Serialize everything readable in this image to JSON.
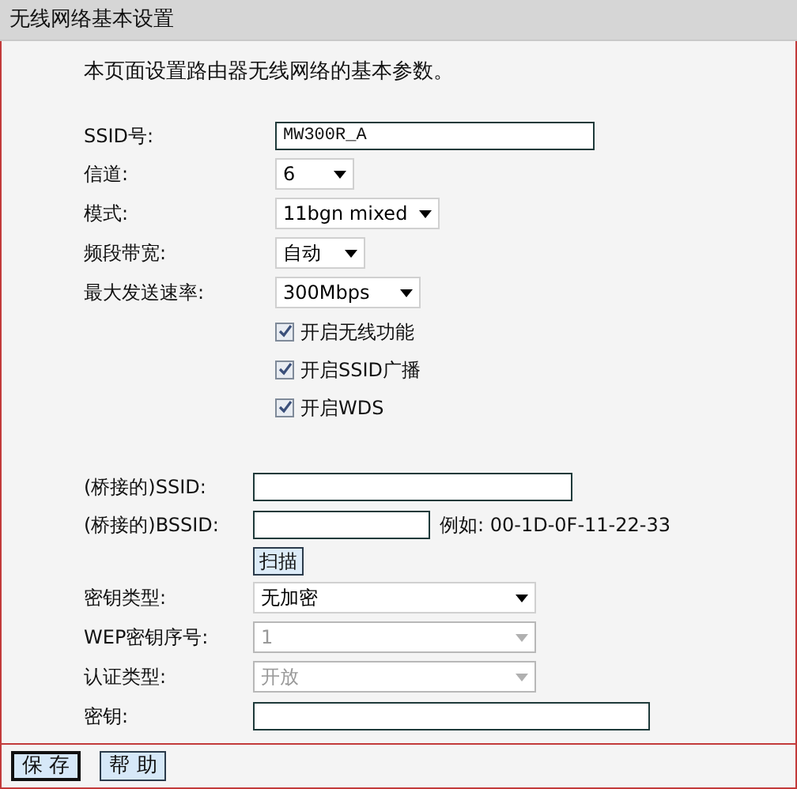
{
  "header": {
    "title": "无线网络基本设置"
  },
  "intro": "本页面设置路由器无线网络的基本参数。",
  "basic": [
    {
      "kind": "text",
      "label": "SSID号:",
      "value": "MW300R_A"
    },
    {
      "kind": "select",
      "label": "信道:",
      "value": "6",
      "disabled": false
    },
    {
      "kind": "select",
      "label": "模式:",
      "value": "11bgn mixed",
      "disabled": false
    },
    {
      "kind": "select",
      "label": "频段带宽:",
      "value": "自动",
      "disabled": false
    },
    {
      "kind": "select",
      "label": "最大发送速率:",
      "value": "300Mbps",
      "disabled": false
    },
    {
      "kind": "checkbox",
      "label": "开启无线功能",
      "checked": true
    },
    {
      "kind": "checkbox",
      "label": "开启SSID广播",
      "checked": true
    },
    {
      "kind": "checkbox",
      "label": "开启WDS",
      "checked": true
    }
  ],
  "wds": [
    {
      "kind": "text",
      "label": "(桥接的)SSID:"
    },
    {
      "kind": "text",
      "label": "(桥接的)BSSID:",
      "hint": "例如: 00-1D-0F-11-22-33"
    },
    {
      "kind": "button",
      "label": "扫描"
    },
    {
      "kind": "select",
      "label": "密钥类型:",
      "value": "无加密",
      "disabled": false
    },
    {
      "kind": "select",
      "label": "WEP密钥序号:",
      "value": "1",
      "disabled": true
    },
    {
      "kind": "select",
      "label": "认证类型:",
      "value": "开放",
      "disabled": true
    },
    {
      "kind": "text",
      "label": "密钥:"
    }
  ],
  "footer": {
    "buttons": [
      "保 存",
      "帮 助"
    ]
  }
}
